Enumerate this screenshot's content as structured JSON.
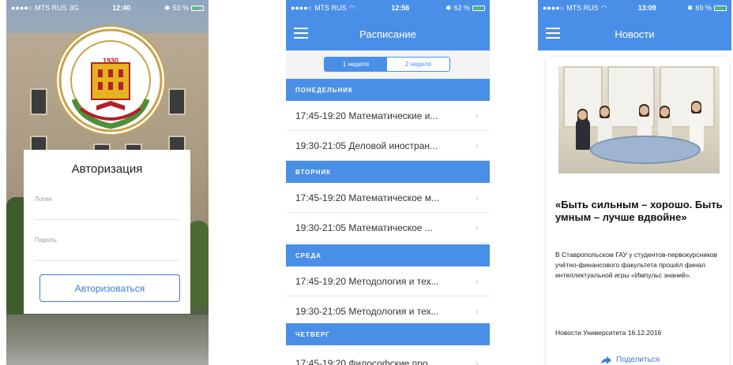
{
  "login_screen": {
    "status": {
      "carrier": "MTS RUS",
      "network": "3G",
      "time": "12:40",
      "battery": "53 %"
    },
    "logo_year": "1930",
    "title": "Авторизация",
    "login_label": "Логин",
    "password_label": "Пароль",
    "submit_label": "Авторизоваться"
  },
  "schedule_screen": {
    "status": {
      "carrier": "MTS RUS",
      "time": "12:56",
      "battery": "62 %"
    },
    "title": "Расписание",
    "week_tabs": [
      "1 неделя",
      "2 неделя"
    ],
    "days": [
      {
        "name": "ПОНЕДЕЛЬНИК",
        "lessons": [
          "17:45-19:20 Математические и...",
          "19:30-21:05 Деловой иностран..."
        ]
      },
      {
        "name": "ВТОРНИК",
        "lessons": [
          "17:45-19:20 Математическое м...",
          "19:30-21:05 Математическое ..."
        ]
      },
      {
        "name": "СРЕДА",
        "lessons": [
          "17:45-19:20 Методология и тех...",
          "19:30-21:05 Методология и тех..."
        ]
      },
      {
        "name": "ЧЕТВЕРГ",
        "lessons": [
          "17:45-19:20 Философские про..."
        ]
      }
    ],
    "row_icon": "chevron-right-icon"
  },
  "news_screen": {
    "status": {
      "carrier": "MTS RUS",
      "time": "13:09",
      "battery": "69 %"
    },
    "title": "Новости",
    "article": {
      "headline": "«Быть сильным – хорошо. Быть умным – лучше вдвойне»",
      "body": "В Ставропольском ГАУ у студентов-первокурсников учётно-финансового факультета прошёл финал интеллектуальной игры «Импульс знаний».",
      "meta": "Новости Университета 16.12.2016",
      "share_label": "Поделиться"
    }
  },
  "colors": {
    "accent": "#4a8fe7",
    "button_outline": "#3b7bd6"
  }
}
